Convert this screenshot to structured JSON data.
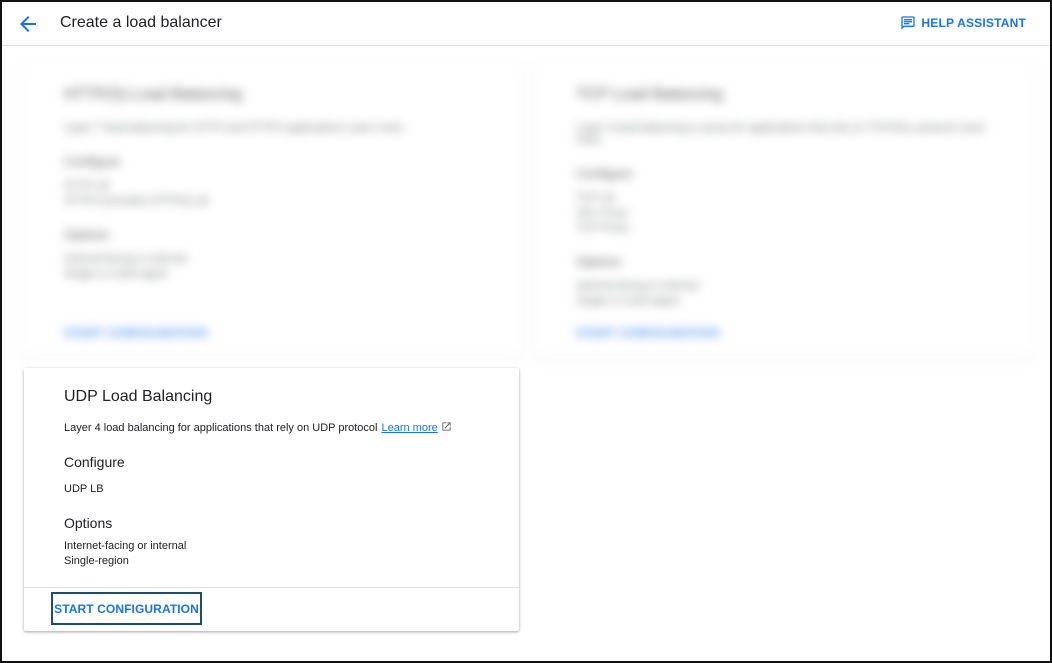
{
  "header": {
    "title": "Create a load balancer",
    "help_label": "HELP ASSISTANT"
  },
  "blurred_cards": [
    {
      "title": "HTTP(S) Load Balancing",
      "description": "Layer 7 load balancing for HTTP and HTTPS applications Learn more",
      "configure_heading": "Configure",
      "configure_lines": [
        "HTTP LB",
        "HTTPS (includes HTTP/2) LB"
      ],
      "options_heading": "Options",
      "options_lines": [
        "Internet-facing or internal",
        "Single or multi-region"
      ],
      "action": "START CONFIGURATION"
    },
    {
      "title": "TCP Load Balancing",
      "description": "Layer 4 load balancing or proxy for applications that rely on TCP/SSL protocol Learn more",
      "configure_heading": "Configure",
      "configure_lines": [
        "TCP LB",
        "SSL Proxy",
        "TCP Proxy"
      ],
      "options_heading": "Options",
      "options_lines": [
        "Internet-facing or internal",
        "Single or multi-region"
      ],
      "action": "START CONFIGURATION"
    }
  ],
  "udp_card": {
    "title": "UDP Load Balancing",
    "description": "Layer 4 load balancing for applications that rely on UDP protocol",
    "learn_more": "Learn more",
    "configure_heading": "Configure",
    "configure_value": "UDP LB",
    "options_heading": "Options",
    "options_line1": "Internet-facing or internal",
    "options_line2": "Single-region",
    "start_button": "START CONFIGURATION"
  },
  "colors": {
    "accent": "#1a73e8",
    "focus_border": "#1f4e6b",
    "divider": "#dadce0"
  },
  "icons": {
    "back": "arrow-left-icon",
    "help": "feedback-chat-icon",
    "external": "external-link-icon"
  }
}
